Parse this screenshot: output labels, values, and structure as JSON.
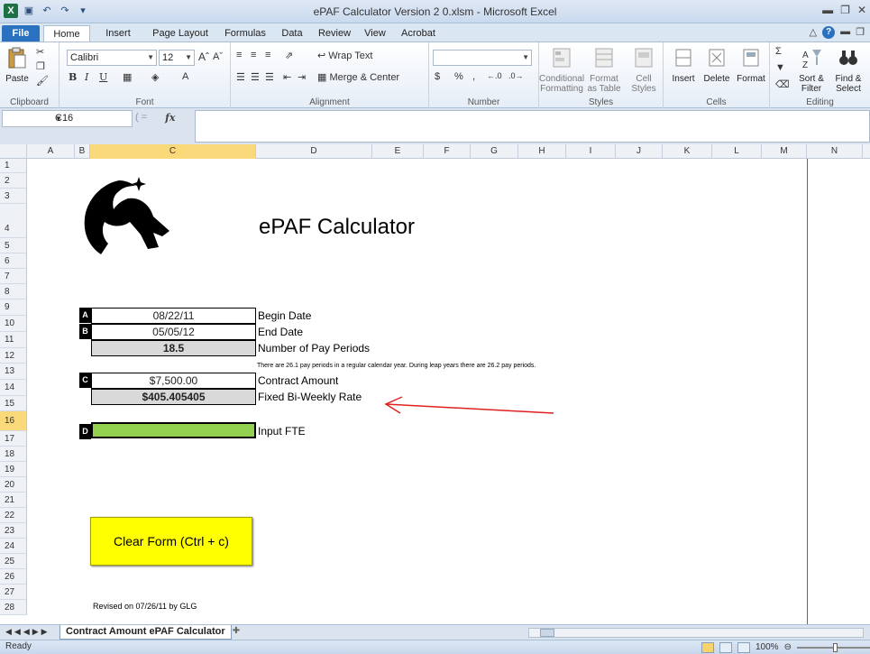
{
  "window": {
    "title": "ePAF Calculator Version 2 0.xlsm  -  Microsoft Excel",
    "app_icon": "excel-icon"
  },
  "ribbon_tabs": [
    "File",
    "Home",
    "Insert",
    "Page Layout",
    "Formulas",
    "Data",
    "Review",
    "View",
    "Acrobat"
  ],
  "active_tab": "Home",
  "ribbon": {
    "clipboard": {
      "paste": "Paste",
      "label": "Clipboard"
    },
    "font": {
      "name": "Calibri",
      "size": "12",
      "label": "Font",
      "bold": "B",
      "italic": "I",
      "underline": "U"
    },
    "alignment": {
      "wrap": "Wrap Text",
      "merge": "Merge & Center",
      "label": "Alignment"
    },
    "number": {
      "format": "",
      "currency": "$",
      "percent": "%",
      "comma": ",",
      "label": "Number"
    },
    "styles": {
      "conditional": "Conditional Formatting",
      "format_table": "Format as Table",
      "cell_styles": "Cell Styles",
      "label": "Styles"
    },
    "cells": {
      "insert": "Insert",
      "delete": "Delete",
      "format": "Format",
      "label": "Cells"
    },
    "editing": {
      "sort": "Sort & Filter",
      "find": "Find & Select",
      "label": "Editing"
    }
  },
  "formula_bar": {
    "name_box": "C16",
    "fx": "fx",
    "formula": ""
  },
  "columns": [
    "A",
    "B",
    "C",
    "D",
    "E",
    "F",
    "G",
    "H",
    "I",
    "J",
    "K",
    "L",
    "M",
    "N"
  ],
  "selected_column": "C",
  "rows": [
    "1",
    "2",
    "3",
    "4",
    "5",
    "6",
    "7",
    "8",
    "9",
    "10",
    "11",
    "12",
    "13",
    "14",
    "15",
    "16",
    "17",
    "18",
    "19",
    "20",
    "21",
    "22",
    "23",
    "24",
    "25",
    "26",
    "27",
    "28"
  ],
  "selected_row": "16",
  "sheet": {
    "title": "ePAF Calculator",
    "fields": {
      "begin_date": {
        "tag": "A",
        "value": "08/22/11",
        "label": "Begin Date"
      },
      "end_date": {
        "tag": "B",
        "value": "05/05/12",
        "label": "End Date"
      },
      "pay_periods": {
        "value": "18.5",
        "label": "Number of Pay Periods"
      },
      "note": "There are 26.1 pay periods in a regular calendar year.  During leap years there are 26.2 pay periods.",
      "contract_amount": {
        "tag": "C",
        "value": "$7,500.00",
        "label": "Contract Amount"
      },
      "biweekly_rate": {
        "value": "$405.405405",
        "label": "Fixed Bi-Weekly Rate"
      },
      "fte": {
        "tag": "D",
        "value": "",
        "label": "Input FTE"
      }
    },
    "clear_button": "Clear Form (Ctrl + c)",
    "revised": "Revised on 07/26/11 by GLG",
    "arrow_color": "#e02020",
    "fte_fill": "#92d050",
    "button_fill": "#ffff00"
  },
  "sheet_tab": "Contract Amount ePAF Calculator",
  "status": {
    "text": "Ready",
    "zoom": "100%"
  }
}
